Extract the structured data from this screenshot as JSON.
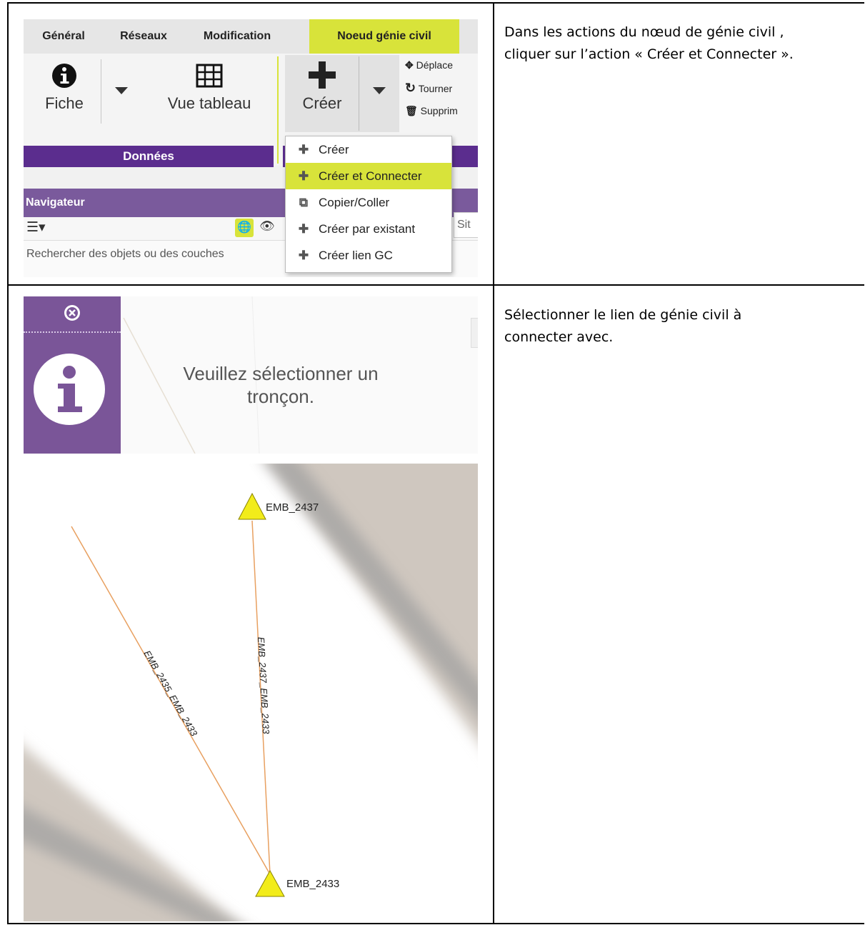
{
  "rows": [
    {
      "instruction_line1": "Dans les actions du nœud de génie civil ,",
      "instruction_line2": "cliquer sur l’action « Créer et Connecter »."
    },
    {
      "instruction_line1": "Sélectionner le lien de génie civil à",
      "instruction_line2": "connecter avec."
    }
  ],
  "ribbon": {
    "tabs": [
      "Général",
      "Réseaux",
      "Modification",
      "Noeud génie civil"
    ],
    "fiche_label": "Fiche",
    "vue_tableau_label": "Vue tableau",
    "creer_label": "Créer",
    "side_actions": [
      "Déplace",
      "Tourner",
      "Supprim"
    ],
    "group_donnees": "Données",
    "navigator_title": "Navigateur",
    "search_placeholder": "Rechercher des objets ou des couches",
    "sit_text": "Sit",
    "dropdown_items": [
      "Créer",
      "Créer et Connecter",
      "Copier/Coller",
      "Créer par existant",
      "Créer lien GC"
    ],
    "selected_item": "Créer et Connecter",
    "accent_color": "#d8e33a",
    "group_color": "#5b2d8e"
  },
  "info_popup": {
    "message_line1": "Veuillez sélectionner un",
    "message_line2": "tronçon.",
    "icons": [
      "close-circle-icon",
      "info-icon"
    ]
  },
  "map": {
    "nodes": [
      "EMB_2437",
      "EMB_2433"
    ],
    "links": [
      "EMB_2435_EMB_2433",
      "EMB_2437_EMB_2433"
    ],
    "link_color": "#e8a060",
    "node_color": "#f2ec1a"
  }
}
